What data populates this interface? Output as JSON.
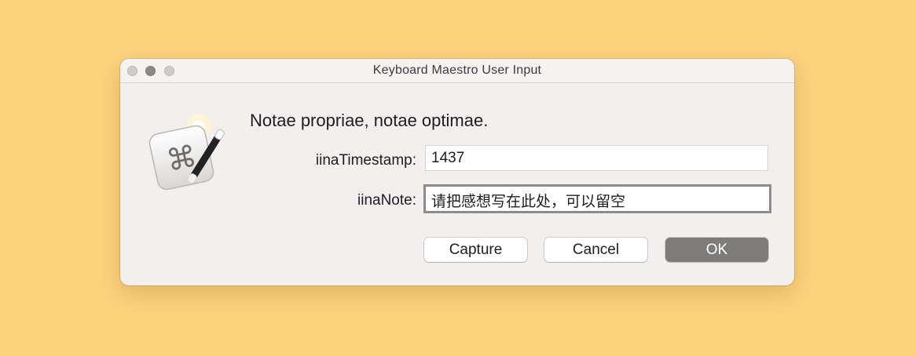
{
  "window": {
    "title": "Keyboard Maestro User Input"
  },
  "dialog": {
    "heading": "Notae propriae, notae optimae.",
    "fields": [
      {
        "label": "iinaTimestamp:",
        "value": "1437"
      },
      {
        "label": "iinaNote:",
        "value": "请把感想写在此处，可以留空"
      }
    ],
    "buttons": {
      "capture": "Capture",
      "cancel": "Cancel",
      "ok": "OK"
    }
  },
  "icons": {
    "app_icon": "keyboard-maestro-icon",
    "command_symbol": "⌘"
  },
  "colors": {
    "desktop_background": "#fdd27d",
    "default_button": "#7e7c7b"
  }
}
